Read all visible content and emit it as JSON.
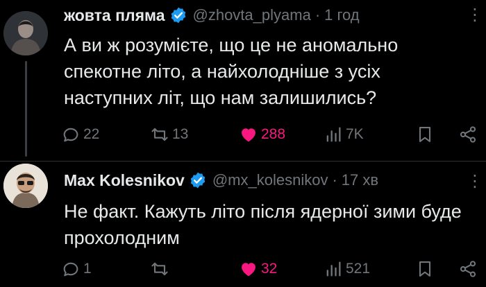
{
  "tweets": [
    {
      "name": "жовта пляма",
      "handle": "@zhovta_plyama",
      "dot": "·",
      "time": "1 год",
      "text": "А ви ж розумієте, що це не аномально спекотне літо, а найхолодніше з усіх наступних літ, що нам залишились?",
      "replies": "22",
      "reposts": "13",
      "likes": "288",
      "views": "7K",
      "liked": true
    },
    {
      "name": "Max Kolesnikov",
      "handle": "@mx_kolesnikov",
      "dot": "·",
      "time": "17 хв",
      "text": "Не факт. Кажуть літо після ядерної зими буде прохолодним",
      "replies": "1",
      "reposts": "",
      "likes": "32",
      "views": "521",
      "liked": true
    }
  ],
  "icons": {
    "verified": "verified-badge-icon",
    "reply": "reply-icon",
    "repost": "repost-icon",
    "like": "heart-icon",
    "views": "views-icon",
    "bookmark": "bookmark-icon",
    "share": "share-icon",
    "more": "more-icon"
  },
  "colors": {
    "background": "#000000",
    "text": "#e7e9ea",
    "muted": "#71767b",
    "verified": "#1d9bf0",
    "like": "#f91880"
  }
}
